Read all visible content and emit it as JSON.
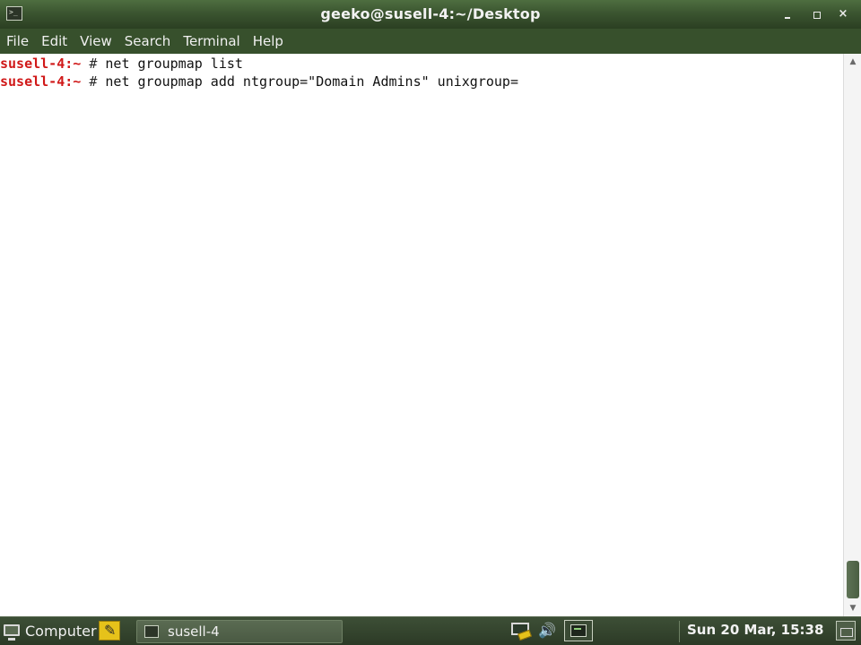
{
  "window": {
    "title": "geeko@susell-4:~/Desktop",
    "icon": "terminal-icon",
    "controls": {
      "minimize_icon": "minimize-icon",
      "maximize_icon": "maximize-icon",
      "close_icon": "close-icon",
      "close_glyph": "×"
    }
  },
  "menubar": {
    "items": [
      "File",
      "Edit",
      "View",
      "Search",
      "Terminal",
      "Help"
    ]
  },
  "terminal": {
    "lines": [
      {
        "host": "susell-4:~",
        "symbol": " # ",
        "command": "net groupmap list"
      },
      {
        "host": "susell-4:~",
        "symbol": " # ",
        "command": "net groupmap add ntgroup=\"Domain Admins\" unixgroup="
      }
    ],
    "colors": {
      "prompt_host": "#d01818",
      "text": "#111111",
      "background": "#ffffff"
    }
  },
  "scrollbar": {
    "up_glyph": "▲",
    "down_glyph": "▼"
  },
  "taskbar": {
    "computer_label": "Computer",
    "task_label": "susell-4",
    "volume_glyph": "🔊",
    "clock": "Sun 20 Mar, 15:38"
  }
}
